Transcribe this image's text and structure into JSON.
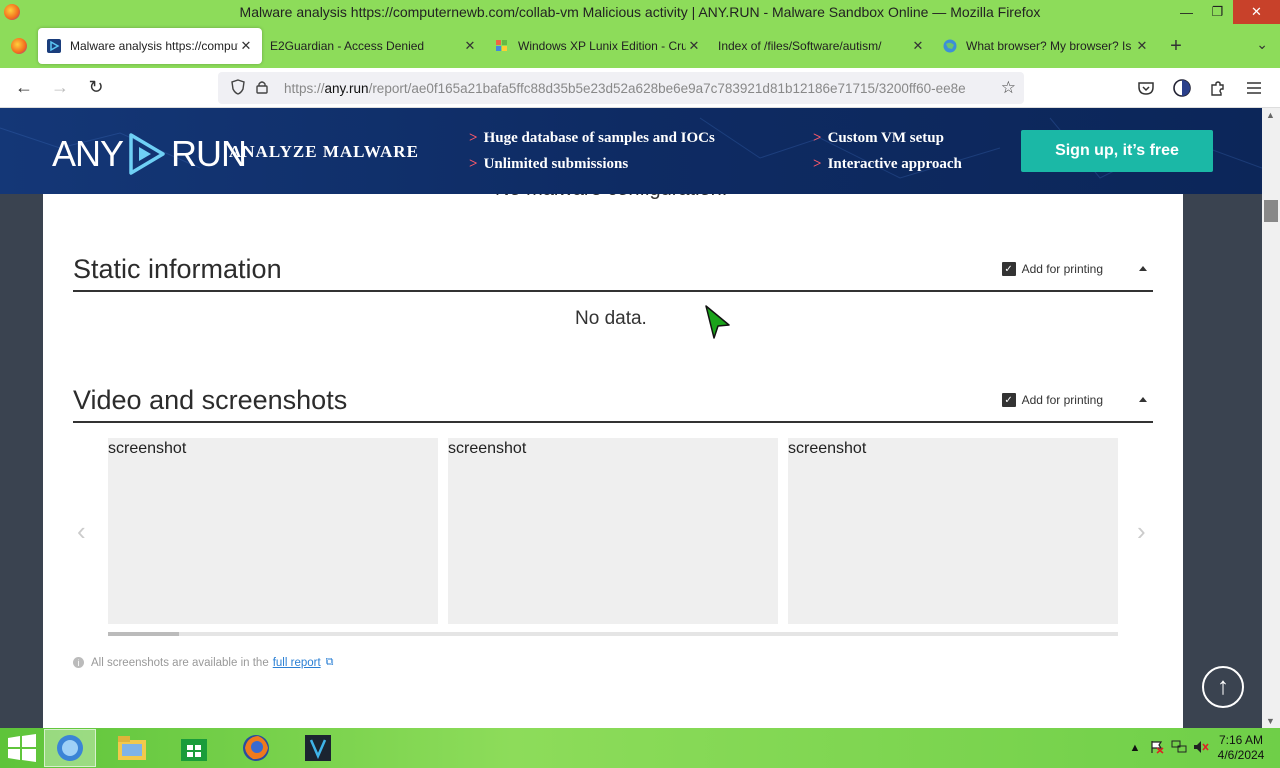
{
  "window": {
    "title": "Malware analysis https://computernewb.com/collab-vm Malicious activity | ANY.RUN - Malware Sandbox Online — Mozilla Firefox",
    "minimize": "—",
    "restore": "❐",
    "close": "✕"
  },
  "tabs": [
    {
      "label": "Malware analysis https://computernewb.com/collab-vm",
      "close": "✕",
      "icon": "anyrun-favicon"
    },
    {
      "label": "E2Guardian - Access Denied",
      "close": "✕",
      "icon": "none"
    },
    {
      "label": "Windows XP Lunix Edition - Crunchyroll",
      "close": "✕",
      "icon": "xp-favicon"
    },
    {
      "label": "Index of /files/Software/autism/",
      "close": "✕",
      "icon": "none"
    },
    {
      "label": "What browser? My browser? Is my browser",
      "close": "✕",
      "icon": "globe-favicon"
    }
  ],
  "tabbar": {
    "new_tab": "+",
    "list_all": "⌄"
  },
  "navbar": {
    "back": "←",
    "forward": "→",
    "reload": "↻",
    "url_prefix": "https://",
    "url_host": "any.run",
    "url_path": "/report/ae0f165a21bafa5ffc88d35b5e23d52a628be6e9a7c783921d81b12186e71715/3200ff60-ee8e"
  },
  "banner": {
    "logo_left": "ANY",
    "logo_right": "RUN",
    "tagline": "ANALYZE MALWARE",
    "features": [
      "Huge database of samples and IOCs",
      "Unlimited submissions",
      "Custom VM setup",
      "Interactive approach"
    ],
    "feature_marker": ">",
    "signup": "Sign up, it’s free"
  },
  "content": {
    "cut_text": "No malware configuration.",
    "static": {
      "title": "Static information",
      "print_label": "Add for printing",
      "no_data": "No data."
    },
    "video": {
      "title": "Video and screenshots",
      "print_label": "Add for printing"
    },
    "screenshots": [
      "screenshot",
      "screenshot",
      "screenshot"
    ],
    "prev": "‹",
    "next": "›",
    "carousel_position": 0.07,
    "note_text": "All screenshots are available in the",
    "note_link": "full report",
    "note_info": "i",
    "note_ext": "⧉"
  },
  "to_top": "↑",
  "taskbar": {
    "time": "7:16 AM",
    "date": "4/6/2024",
    "tray_up": "▲"
  },
  "colors": {
    "window_chrome": "#8ddc5a",
    "banner": "#0f2d6b",
    "signup": "#1bb8a6",
    "feature_marker": "#ff5a6a",
    "link": "#2a7fd4"
  }
}
